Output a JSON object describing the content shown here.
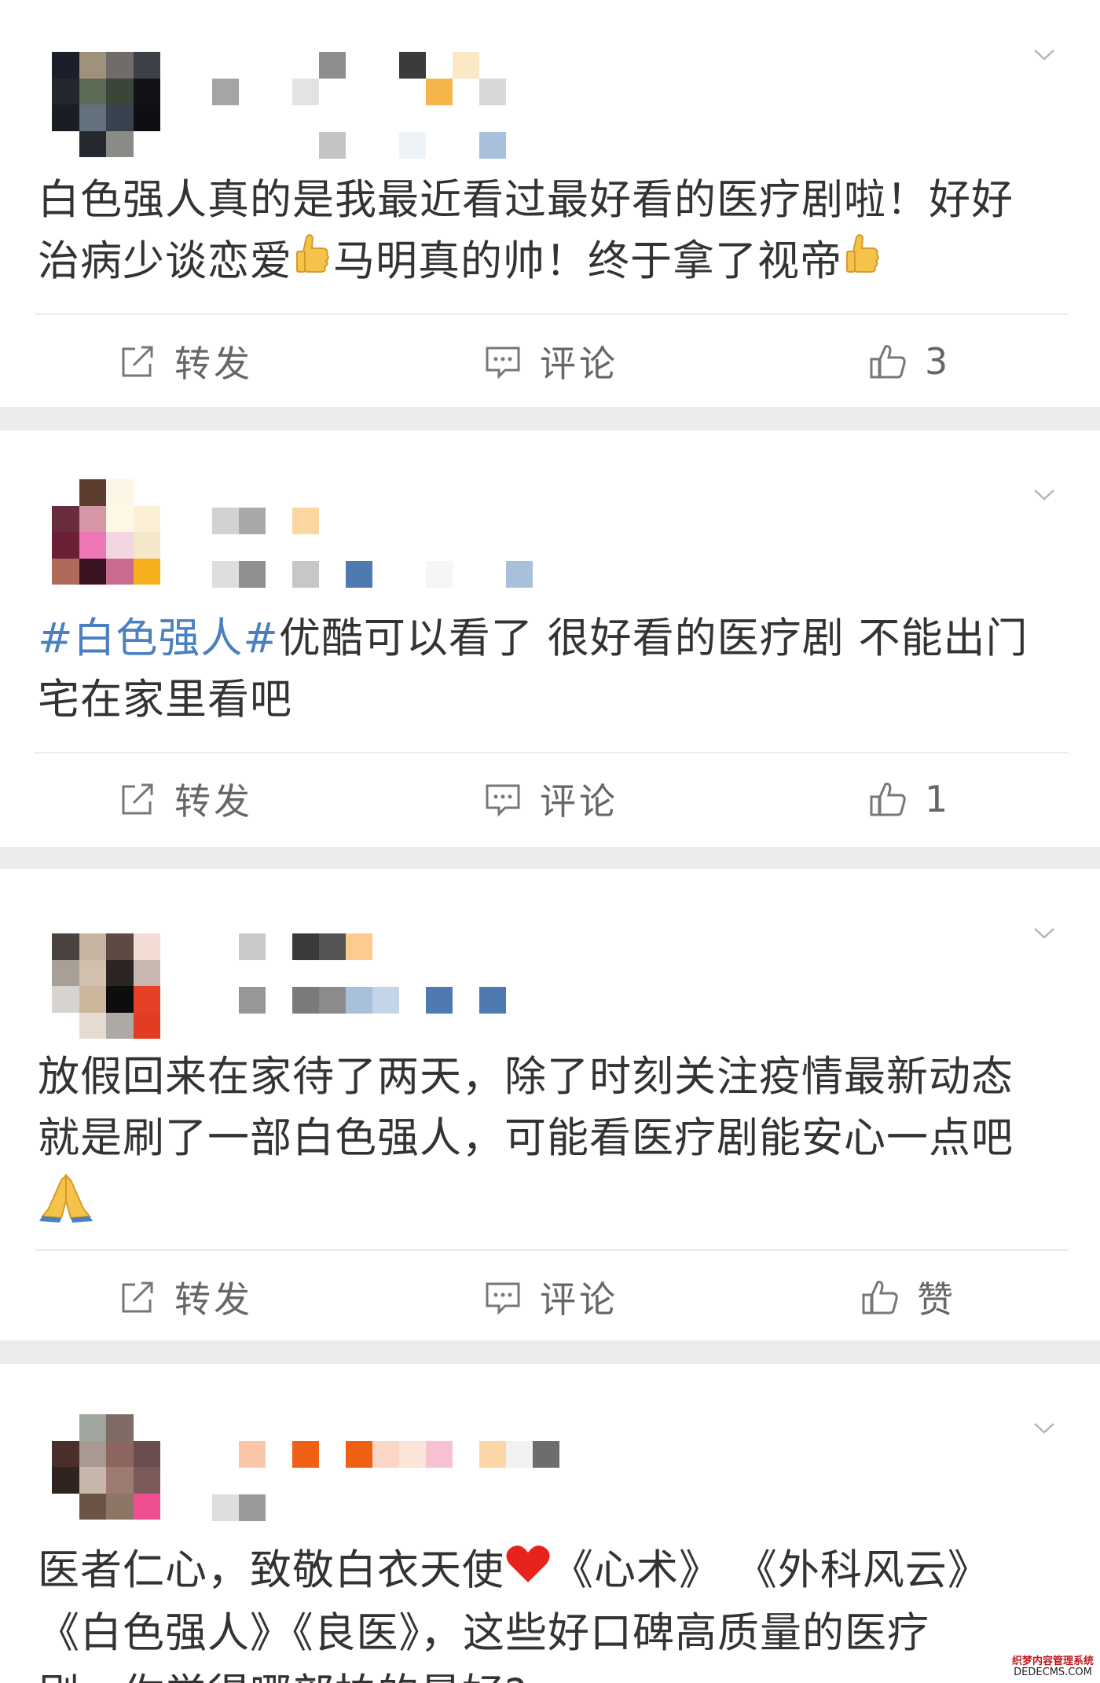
{
  "posts": [
    {
      "text": "白色强人真的是我最近看过最好看的医疗剧啦！好好治病少谈恋爱👍马明真的帅！终于拿了视帝👍",
      "line1": "白色强人真的是我最近看过最好看的医疗剧啦！好好",
      "line2a": "治病少谈恋爱",
      "line2b": "马明真的帅！终于拿了视帝",
      "repost": "转发",
      "comment": "评论",
      "like": "3"
    },
    {
      "topic": "#白色强人#",
      "line1": "优酷可以看了  很好看的医疗剧  不能出门",
      "line2": "宅在家里看吧",
      "repost": "转发",
      "comment": "评论",
      "like": "1"
    },
    {
      "line1": "放假回来在家待了两天，除了时刻关注疫情最新动态",
      "line2": "就是刷了一部白色强人，可能看医疗剧能安心一点吧",
      "repost": "转发",
      "comment": "评论",
      "like": "赞"
    },
    {
      "line1a": "医者仁心，致敬白衣天使",
      "line1b": "《心术》  《外科风云》",
      "line2": "《白色强人》《良医》，这些好口碑高质量的医疗",
      "line3": "剧，你觉得哪部拍的最好?"
    }
  ],
  "watermark": {
    "line1": "织梦内容管理系统",
    "line2": "DEDECMS.COM"
  },
  "colors": {
    "topic": "#4a7fc0",
    "text": "#333333",
    "action": "#666666",
    "separator": "#ececec"
  },
  "icons": [
    "chevron-down-icon",
    "repost-icon",
    "comment-icon",
    "thumbs-up-icon",
    "thumbs-up-emoji",
    "pray-emoji",
    "heart-emoji"
  ]
}
